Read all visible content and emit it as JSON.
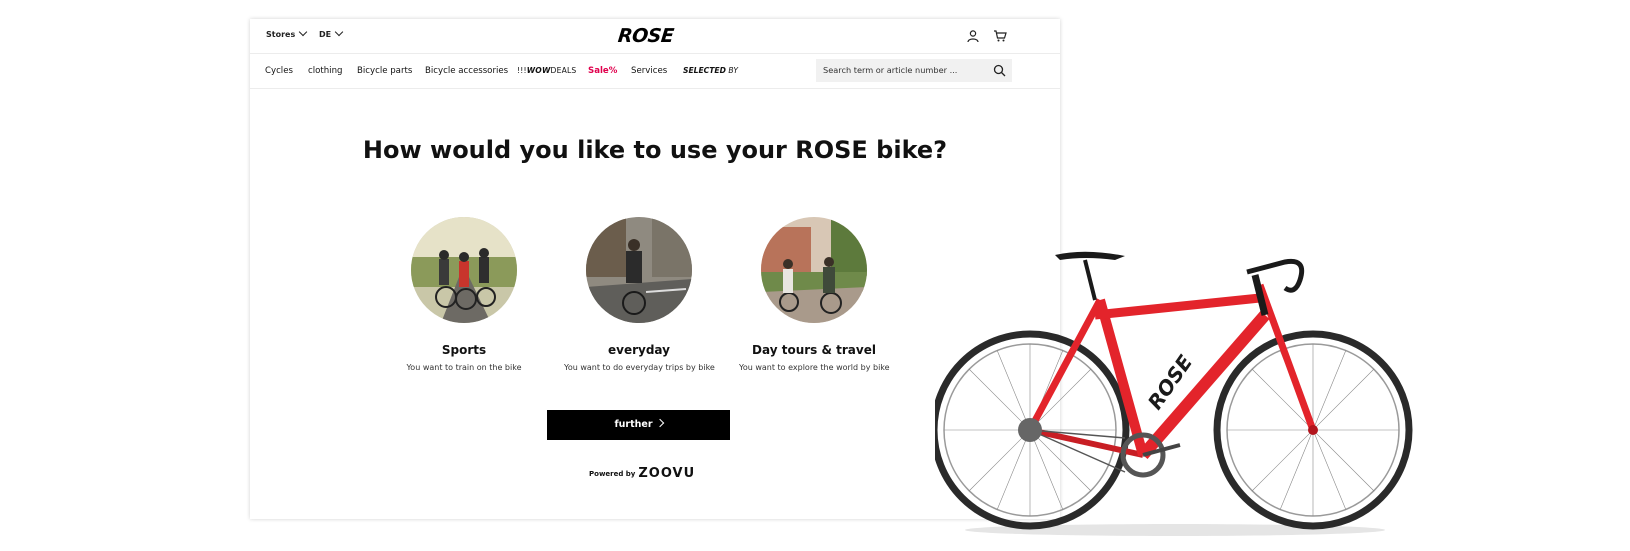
{
  "header": {
    "stores_label": "Stores",
    "lang_label": "DE",
    "logo": "ROSE",
    "icons": [
      "user-icon",
      "cart-icon"
    ]
  },
  "nav": {
    "items": [
      "Cycles",
      "clothing",
      "Bicycle parts",
      "Bicycle accessories"
    ],
    "wow_prefix": "!!!",
    "wow_bold": "WOW",
    "wow_suffix": "DEALS",
    "sale": "Sale%",
    "services": "Services",
    "selected_bold": "SELECTED",
    "selected_suffix": " BY"
  },
  "search": {
    "placeholder": "Search term or article number ..."
  },
  "main": {
    "title": "How would you like to use your ROSE bike?",
    "options": [
      {
        "title": "Sports",
        "desc": "You want to train on the bike"
      },
      {
        "title": "everyday",
        "desc": "You want to do everyday trips by bike"
      },
      {
        "title": "Day tours & travel",
        "desc": "You want to explore the world by bike"
      }
    ],
    "button": "further",
    "powered_label": "Powered by",
    "powered_brand": "ZOOVU"
  },
  "colors": {
    "sale": "#e0004d",
    "button": "#000000",
    "bike_frame": "#e3242b"
  }
}
